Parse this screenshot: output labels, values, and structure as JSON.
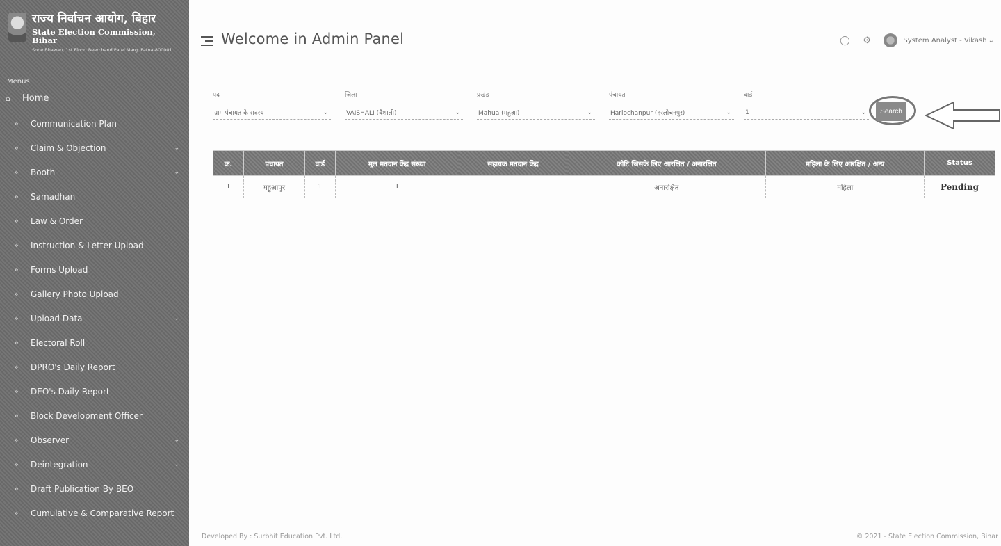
{
  "brand": {
    "hindi": "राज्य निर्वाचन आयोग, बिहार",
    "english": "State Election Commission, Bihar",
    "address": "Sone Bhawan, 1st Floor, Beerchand Patel Marg, Patna-800001"
  },
  "sidebar": {
    "heading": "Menus",
    "items": [
      {
        "label": "Home",
        "icon": "home-icon",
        "has_caret": false
      },
      {
        "label": "Communication Plan",
        "icon": "double-chevron-icon",
        "has_caret": false
      },
      {
        "label": "Claim & Objection",
        "icon": "double-chevron-icon",
        "has_caret": true
      },
      {
        "label": "Booth",
        "icon": "double-chevron-icon",
        "has_caret": true
      },
      {
        "label": "Samadhan",
        "icon": "double-chevron-icon",
        "has_caret": false
      },
      {
        "label": "Law & Order",
        "icon": "double-chevron-icon",
        "has_caret": false
      },
      {
        "label": "Instruction & Letter Upload",
        "icon": "double-chevron-icon",
        "has_caret": false
      },
      {
        "label": "Forms Upload",
        "icon": "double-chevron-icon",
        "has_caret": false
      },
      {
        "label": "Gallery Photo Upload",
        "icon": "double-chevron-icon",
        "has_caret": false
      },
      {
        "label": "Upload Data",
        "icon": "double-chevron-icon",
        "has_caret": true
      },
      {
        "label": "Electoral Roll",
        "icon": "double-chevron-icon",
        "has_caret": false
      },
      {
        "label": "DPRO's Daily Report",
        "icon": "double-chevron-icon",
        "has_caret": false
      },
      {
        "label": "DEO's Daily Report",
        "icon": "double-chevron-icon",
        "has_caret": false
      },
      {
        "label": "Block Development Officer",
        "icon": "double-chevron-icon",
        "has_caret": false
      },
      {
        "label": "Observer",
        "icon": "double-chevron-icon",
        "has_caret": true
      },
      {
        "label": "Deintegration",
        "icon": "double-chevron-icon",
        "has_caret": true
      },
      {
        "label": "Draft Publication By BEO",
        "icon": "double-chevron-icon",
        "has_caret": false
      },
      {
        "label": "Cumulative & Comparative Report",
        "icon": "double-chevron-icon",
        "has_caret": false
      }
    ]
  },
  "header": {
    "title": "Welcome in Admin Panel",
    "user": "System Analyst - Vikash"
  },
  "filters": [
    {
      "label": "पद",
      "value": "ग्राम पंचायत के सदस्य"
    },
    {
      "label": "जिला",
      "value": "VAISHALI (वैशाली)"
    },
    {
      "label": "प्रखंड",
      "value": "Mahua (महुआ)"
    },
    {
      "label": "पंचायत",
      "value": "Harlochanpur (हरलोचनपुर)"
    },
    {
      "label": "वार्ड",
      "value": "1"
    }
  ],
  "search_label": "Search",
  "table": {
    "headers": [
      "क्र.",
      "पंचायत",
      "वार्ड",
      "मूल मतदान केंद्र संख्या",
      "सहायक मतदान केंद्र",
      "कोटि जिसके लिए आरक्षित / अनारक्षित",
      "महिला के लिए आरक्षित / अन्य",
      "Status"
    ],
    "rows": [
      [
        "1",
        "महुआपुर",
        "1",
        "1",
        "",
        "अनारक्षित",
        "महिला",
        "Pending"
      ]
    ]
  },
  "footer": {
    "left": "Developed By : Surbhit Education Pvt. Ltd.",
    "right": "© 2021 - State Election Commission, Bihar"
  },
  "colors": {
    "sidebar_bg": "#6e6e6e",
    "table_header_bg": "#7a7a7a",
    "search_button": "#8a8a8a"
  }
}
